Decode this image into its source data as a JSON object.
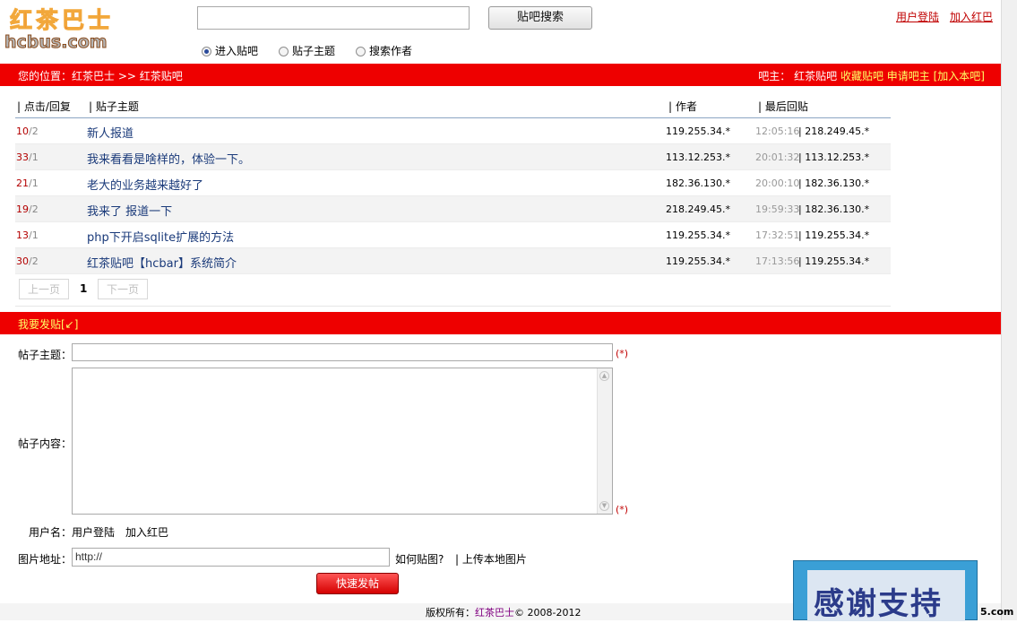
{
  "logo": {
    "cn": "红茶巴士",
    "en": "hcbus.com"
  },
  "search": {
    "placeholder": "",
    "button": "贴吧搜索"
  },
  "search_options": [
    {
      "label": "进入贴吧",
      "selected": true
    },
    {
      "label": "贴子主题",
      "selected": false
    },
    {
      "label": "搜索作者",
      "selected": false
    }
  ],
  "top_links": {
    "login": "用户登陆",
    "join": "加入红巴"
  },
  "location_bar": {
    "prefix": "您的位置：",
    "crumb1": "红茶巴士",
    "sep": " >> ",
    "crumb2": "红茶贴吧",
    "owner_label": "吧主：",
    "owner": "红茶贴吧",
    "favorite": "收藏贴吧",
    "apply": "申请吧主",
    "join": "[加入本吧]"
  },
  "table": {
    "headers": {
      "clicks": "| 点击/回复",
      "topic": "| 贴子主题",
      "author": "| 作者",
      "last": "| 最后回贴"
    },
    "rows": [
      {
        "clicks": "10",
        "replies": "/2",
        "title": "新人报道",
        "author": "119.255.34.*",
        "time": "12:05:16",
        "last": "| 218.249.45.*"
      },
      {
        "clicks": "33",
        "replies": "/1",
        "title": "我来看看是啥样的，体验一下。",
        "author": "113.12.253.*",
        "time": "20:01:32",
        "last": "| 113.12.253.*"
      },
      {
        "clicks": "21",
        "replies": "/1",
        "title": "老大的业务越来越好了",
        "author": "182.36.130.*",
        "time": "20:00:10",
        "last": "| 182.36.130.*"
      },
      {
        "clicks": "19",
        "replies": "/2",
        "title": "我来了 报道一下",
        "author": "218.249.45.*",
        "time": "19:59:33",
        "last": "| 182.36.130.*"
      },
      {
        "clicks": "13",
        "replies": "/1",
        "title": "php下开启sqlite扩展的方法",
        "author": "119.255.34.*",
        "time": "17:32:51",
        "last": "| 119.255.34.*"
      },
      {
        "clicks": "30",
        "replies": "/2",
        "title": "红茶贴吧【hcbar】系统简介",
        "author": "119.255.34.*",
        "time": "17:13:56",
        "last": "| 119.255.34.*"
      }
    ]
  },
  "pager": {
    "prev": "上一页",
    "current": "1",
    "next": "下一页"
  },
  "post_bar": {
    "title": "我要发贴[↙]"
  },
  "form": {
    "subject_label": "帖子主题：",
    "required": "(*)",
    "content_label": "帖子内容：",
    "username_label": "用户名：",
    "login_link": "用户登陆",
    "join_link": "加入红巴",
    "image_label": "图片地址：",
    "image_value": "http://",
    "how_to": "如何贴图?",
    "upload": "| 上传本地图片",
    "submit": "快速发帖"
  },
  "footer": {
    "prefix": "版权所有：",
    "brand": "红茶巴士",
    "suffix": "© 2008-2012"
  },
  "thanks_badge": {
    "text": "感谢支持",
    "tail": "5.com"
  },
  "colors": {
    "red_bar": "#ee0000",
    "link_red": "#c00000",
    "title_blue": "#1a3a7a",
    "owner_yellow": "#ffff66"
  }
}
